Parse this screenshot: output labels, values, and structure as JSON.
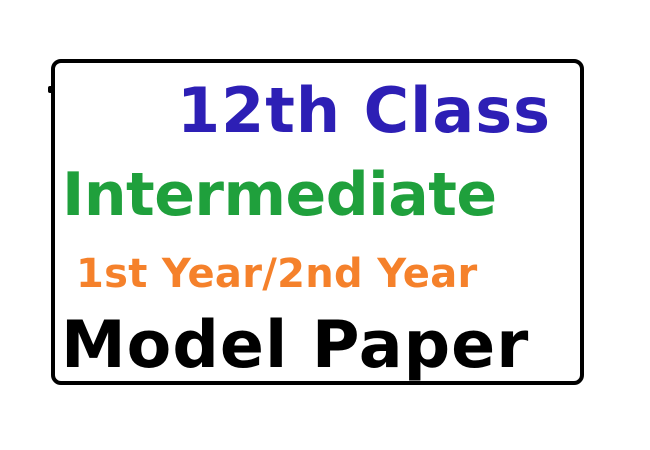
{
  "banner": {
    "line1": "12th Class",
    "line2": "Intermediate",
    "line3": "1st Year/2nd Year",
    "line4": "Model Paper"
  },
  "colors": {
    "line1": "#2d1fb5",
    "line2": "#1fa03c",
    "line3": "#f5812b",
    "line4": "#000000",
    "frame": "#000000",
    "background": "#ffffff"
  }
}
